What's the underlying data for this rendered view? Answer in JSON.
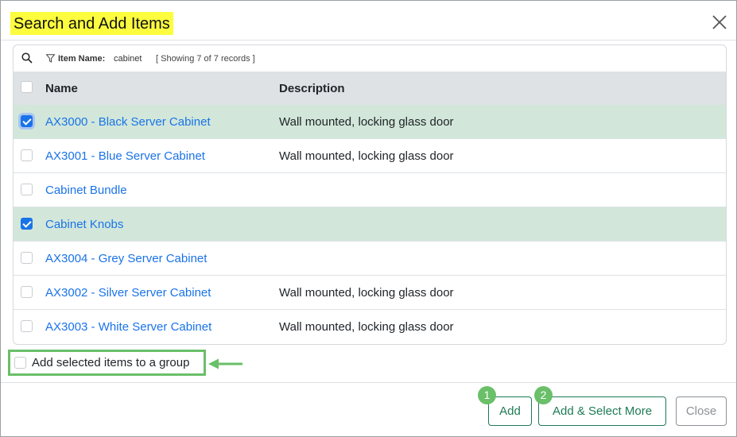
{
  "modal": {
    "title": "Search and Add Items",
    "close_icon": "close-icon"
  },
  "filter": {
    "search_icon": "search-icon",
    "filter_icon": "filter-icon",
    "label": "Item Name:",
    "value": "cabinet",
    "record_count": "[ Showing 7 of 7 records ]"
  },
  "grid": {
    "columns": [
      "Name",
      "Description"
    ],
    "rows": [
      {
        "name": "AX3000 - Black Server Cabinet",
        "description": "Wall mounted, locking glass door",
        "checked": true
      },
      {
        "name": "AX3001 - Blue Server Cabinet",
        "description": "Wall mounted, locking glass door",
        "checked": false
      },
      {
        "name": "Cabinet Bundle",
        "description": "",
        "checked": false
      },
      {
        "name": "Cabinet Knobs",
        "description": "",
        "checked": true
      },
      {
        "name": "AX3004 - Grey Server Cabinet",
        "description": "",
        "checked": false
      },
      {
        "name": "AX3002 - Silver Server Cabinet",
        "description": "Wall mounted, locking glass door",
        "checked": false
      },
      {
        "name": "AX3003 - White Server Cabinet",
        "description": "Wall mounted, locking glass door",
        "checked": false
      }
    ]
  },
  "group_option": {
    "label": "Add selected items to a group",
    "checked": false
  },
  "footer": {
    "add_label": "Add",
    "add_more_label": "Add & Select More",
    "close_label": "Close",
    "step_1": "1",
    "step_2": "2"
  },
  "colors": {
    "title_highlight": "#fdfd3f",
    "link": "#1a73e8",
    "selected_row": "#d2e7da",
    "annotation_green": "#6abf69",
    "button_green": "#1f7a56"
  }
}
